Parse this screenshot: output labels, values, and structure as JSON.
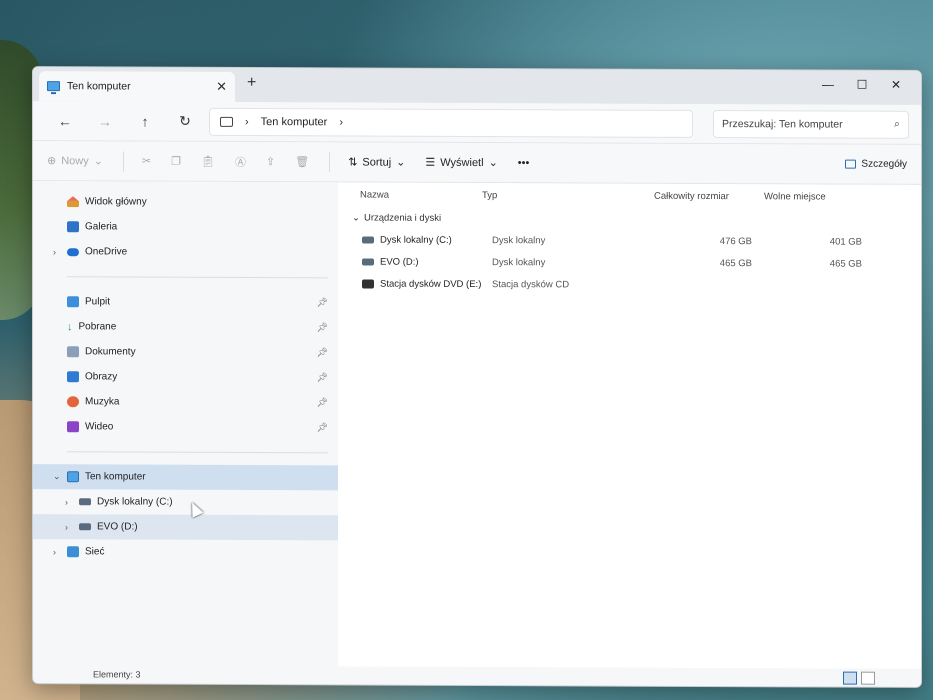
{
  "window": {
    "tab_title": "Ten komputer",
    "new_tab": "+",
    "minimize": "—",
    "maximize": "☐",
    "close": "✕"
  },
  "address": {
    "path": "Ten komputer",
    "search_placeholder": "Przeszukaj: Ten komputer"
  },
  "toolbar": {
    "new_label": "Nowy",
    "sort_label": "Sortuj",
    "view_label": "Wyświetl",
    "more": "•••",
    "details_label": "Szczegóły"
  },
  "sidebar": {
    "home": "Widok główny",
    "gallery": "Galeria",
    "onedrive": "OneDrive",
    "quick": [
      {
        "label": "Pulpit"
      },
      {
        "label": "Pobrane"
      },
      {
        "label": "Dokumenty"
      },
      {
        "label": "Obrazy"
      },
      {
        "label": "Muzyka"
      },
      {
        "label": "Wideo"
      }
    ],
    "this_pc": "Ten komputer",
    "drive_c": "Dysk lokalny (C:)",
    "drive_d": "EVO (D:)",
    "network": "Sieć"
  },
  "main": {
    "columns": [
      "Nazwa",
      "Typ",
      "Całkowity rozmiar",
      "Wolne miejsce"
    ],
    "group": "Urządzenia i dyski",
    "rows": [
      {
        "name": "Dysk lokalny (C:)",
        "type": "Dysk lokalny",
        "total": "476 GB",
        "free": "401 GB"
      },
      {
        "name": "EVO (D:)",
        "type": "Dysk lokalny",
        "total": "465 GB",
        "free": "465 GB"
      },
      {
        "name": "Stacja dysków DVD (E:)",
        "type": "Stacja dysków CD",
        "total": "",
        "free": ""
      }
    ]
  },
  "status": {
    "items": "Elementy: 3"
  }
}
